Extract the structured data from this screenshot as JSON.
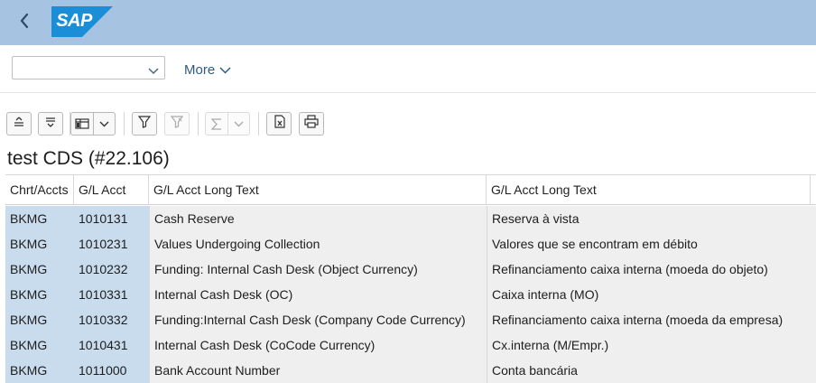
{
  "shell": {
    "back_icon": "chevron-left-icon",
    "logo_text": "SAP",
    "colors": {
      "bar": "#a6c4e1",
      "logo": "#1a8fd8"
    }
  },
  "filter_bar": {
    "variant_value": "",
    "more_label": "More"
  },
  "toolbar": {
    "buttons": [
      "sort-ascending-icon",
      "sort-descending-icon",
      "layout-icon",
      "filter-icon",
      "clear-filter-icon",
      "sum-icon",
      "export-excel-icon",
      "print-icon"
    ]
  },
  "table": {
    "title": "test CDS (#22.106)",
    "columns": [
      "Chrt/Accts",
      "G/L Acct",
      "G/L Acct Long Text",
      "G/L Acct Long Text"
    ],
    "rows": [
      [
        "BKMG",
        "1010131",
        "Cash Reserve",
        "Reserva à vista"
      ],
      [
        "BKMG",
        "1010231",
        "Values Undergoing Collection",
        "Valores que se encontram em débito"
      ],
      [
        "BKMG",
        "1010232",
        "Funding: Internal Cash Desk (Object Currency)",
        "Refinanciamento caixa interna (moeda do objeto)"
      ],
      [
        "BKMG",
        "1010331",
        "Internal Cash Desk (OC)",
        "Caixa interna (MO)"
      ],
      [
        "BKMG",
        "1010332",
        "Funding:Internal Cash Desk (Company Code Currency)",
        "Refinanciamento caixa interna (moeda da empresa)"
      ],
      [
        "BKMG",
        "1010431",
        "Internal Cash Desk (CoCode Currency)",
        "Cx.interna (M/Empr.)"
      ],
      [
        "BKMG",
        "1011000",
        "Bank Account Number",
        "Conta bancária"
      ]
    ]
  }
}
